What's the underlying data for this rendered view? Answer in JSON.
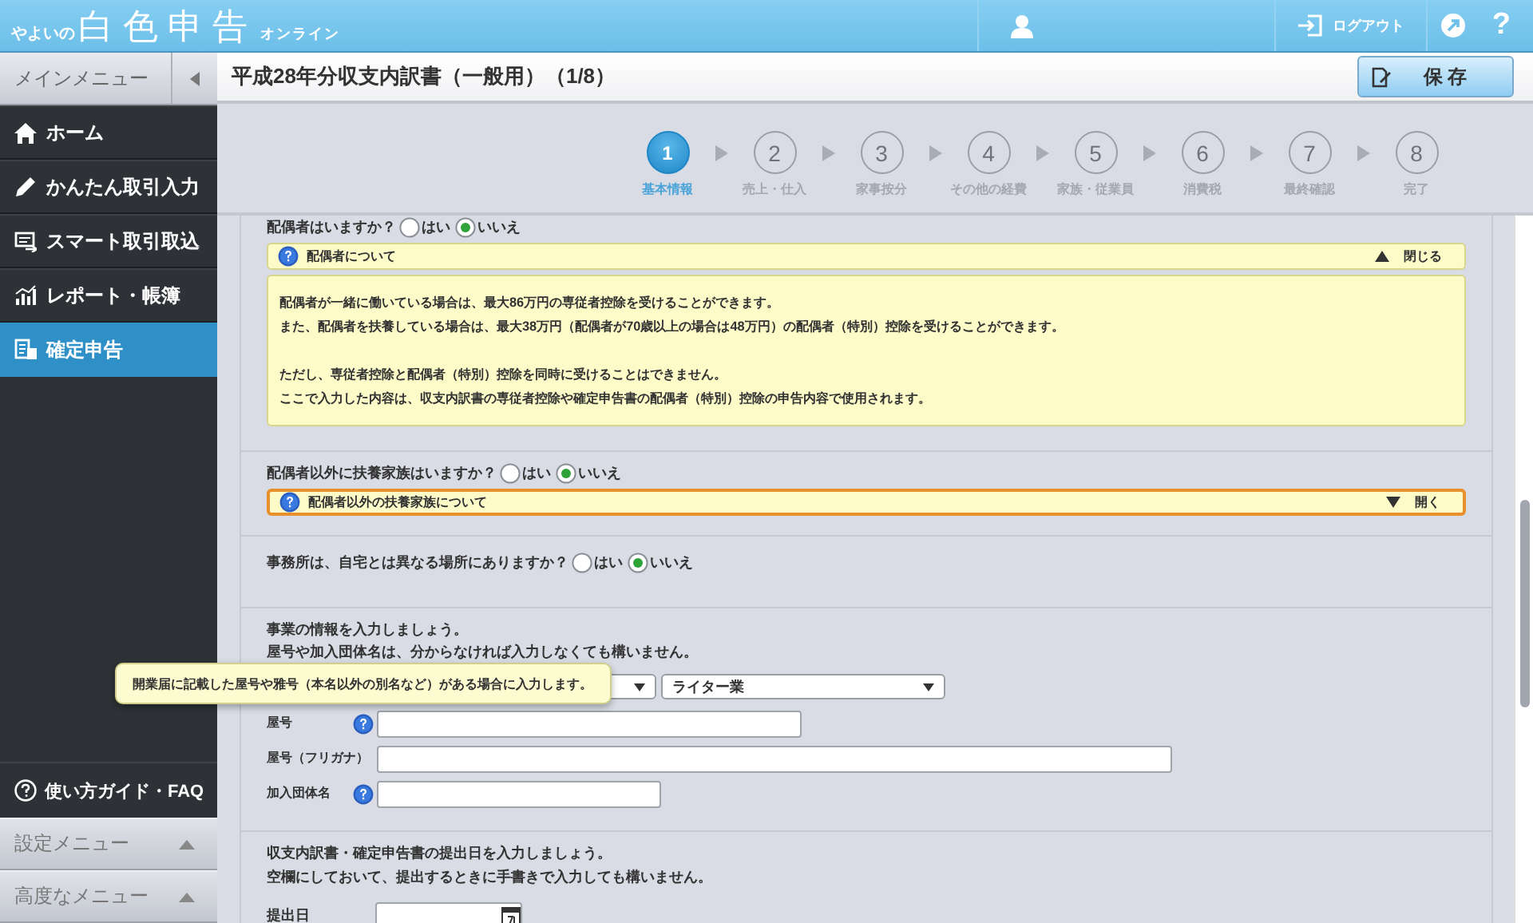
{
  "header": {
    "logo_small": "やよいの",
    "logo_main": "白色申告",
    "logo_suffix": "オンライン",
    "logout": "ログアウト",
    "help": "?"
  },
  "sidebar": {
    "title": "メインメニュー",
    "items": [
      {
        "label": "ホーム",
        "selected": false
      },
      {
        "label": "かんたん取引入力",
        "selected": false
      },
      {
        "label": "スマート取引取込",
        "selected": false
      },
      {
        "label": "レポート・帳簿",
        "selected": false
      },
      {
        "label": "確定申告",
        "selected": true
      }
    ],
    "guide": "使い方ガイド・FAQ",
    "submenus": [
      {
        "label": "設定メニュー"
      },
      {
        "label": "高度なメニュー"
      }
    ]
  },
  "page": {
    "title": "平成28年分収支内訳書（一般用）（1/8）",
    "save": "保 存"
  },
  "steps": [
    {
      "number": "1",
      "label": "基本情報",
      "selected": true
    },
    {
      "number": "2",
      "label": "売上・仕入",
      "selected": false
    },
    {
      "number": "3",
      "label": "家事按分",
      "selected": false
    },
    {
      "number": "4",
      "label": "その他の経費",
      "selected": false
    },
    {
      "number": "5",
      "label": "家族・従業員",
      "selected": false
    },
    {
      "number": "6",
      "label": "消費税",
      "selected": false
    },
    {
      "number": "7",
      "label": "最終確認",
      "selected": false
    },
    {
      "number": "8",
      "label": "完了",
      "selected": false
    }
  ],
  "questions": [
    {
      "question": "配偶者はいますか？",
      "options": [
        {
          "label": "はい",
          "selected": false
        },
        {
          "label": "いいえ",
          "selected": true
        }
      ],
      "info": {
        "title": "配偶者について",
        "expanded": true,
        "toggle": "閉じる",
        "paragraphs": [
          [
            "配偶者が一緒に働いている場合は、最大86万円の専従者控除を受けることができます。",
            "また、配偶者を扶養している場合は、最大38万円（配偶者が70歳以上の場合は48万円）の配偶者（特別）控除を受けることができます。"
          ],
          [
            "ただし、専従者控除と配偶者（特別）控除を同時に受けることはできません。",
            "ここで入力した内容は、収支内訳書の専従者控除や確定申告書の配偶者（特別）控除の申告内容で使用されます。"
          ]
        ]
      }
    },
    {
      "question": "配偶者以外に扶養家族はいますか？",
      "options": [
        {
          "label": "はい",
          "selected": false
        },
        {
          "label": "いいえ",
          "selected": true
        }
      ],
      "info": {
        "title": "配偶者以外の扶養家族について",
        "expanded": false,
        "toggle": "開く"
      }
    },
    {
      "question": "事務所は、自宅とは異なる場所にありますか？",
      "options": [
        {
          "label": "はい",
          "selected": false
        },
        {
          "label": "いいえ",
          "selected": true
        }
      ]
    }
  ],
  "business": {
    "intro": [
      "事業の情報を入力しましょう。",
      "屋号や加入団体名は、分からなければ入力しなくても構いません。"
    ],
    "industry": "ライター業",
    "fields": [
      {
        "label": "屋号",
        "help": true
      },
      {
        "label": "屋号（フリガナ）",
        "help": false
      },
      {
        "label": "加入団体名",
        "help": true
      }
    ],
    "tooltip": "開業届に記載した屋号や雅号（本名以外の別名など）がある場合に入力します。"
  },
  "filing": {
    "intro": [
      "収支内訳書・確定申告書の提出日を入力しましょう。",
      "空欄にしておいて、提出するときに手書きで入力しても構いません。"
    ],
    "date_label": "提出日"
  }
}
